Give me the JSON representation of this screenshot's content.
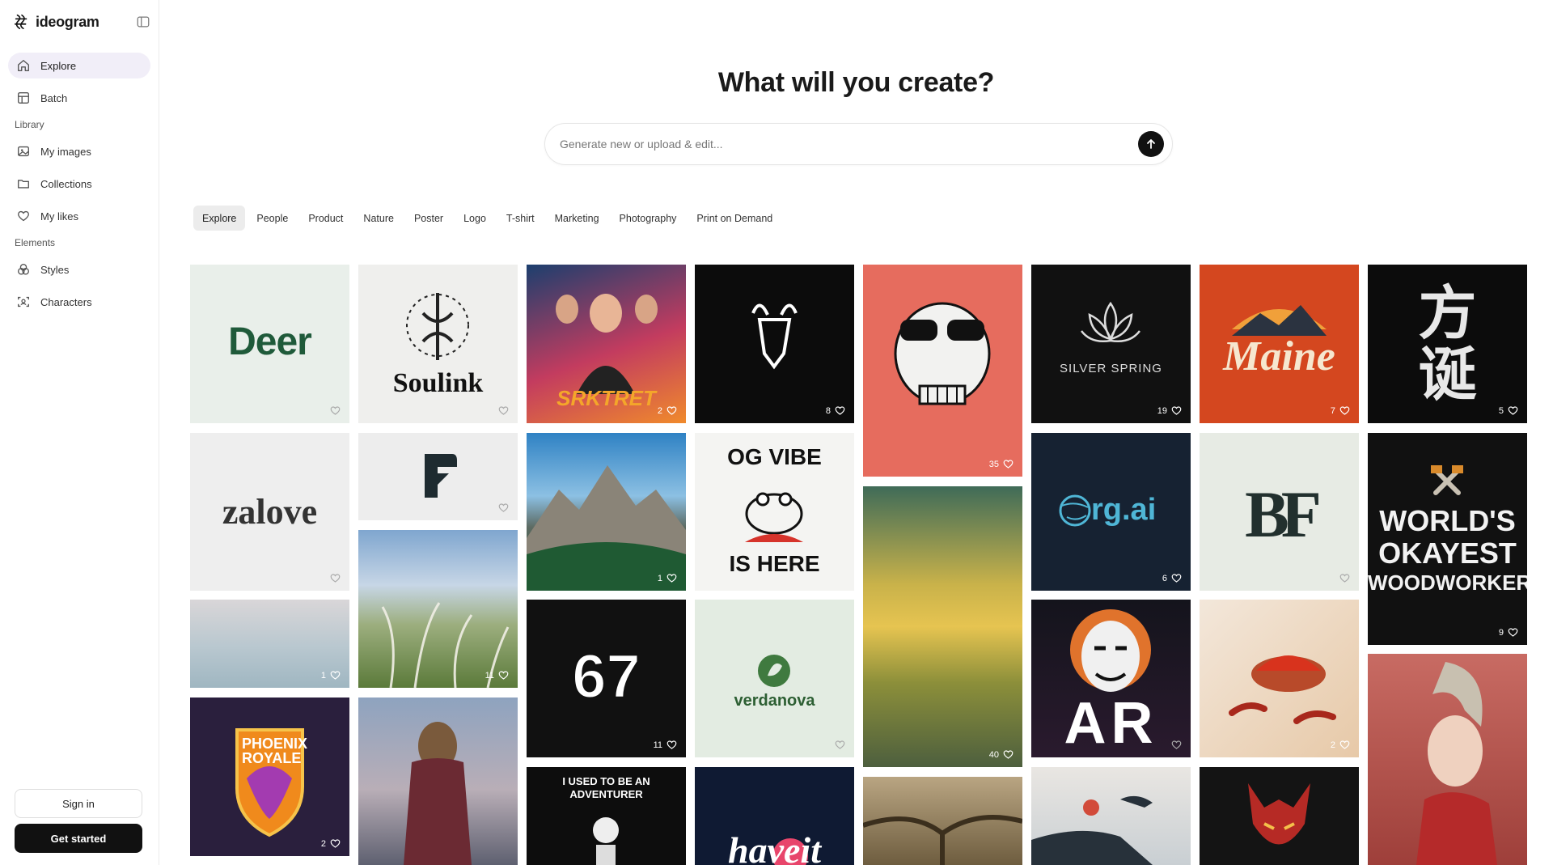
{
  "app": {
    "name": "ideogram"
  },
  "sidebar": {
    "nav": [
      {
        "label": "Explore",
        "icon": "home-icon",
        "active": true
      },
      {
        "label": "Batch",
        "icon": "batch-icon"
      }
    ],
    "library_title": "Library",
    "library": [
      {
        "label": "My images",
        "icon": "images-icon"
      },
      {
        "label": "Collections",
        "icon": "folder-icon"
      },
      {
        "label": "My likes",
        "icon": "heart-icon"
      }
    ],
    "elements_title": "Elements",
    "elements": [
      {
        "label": "Styles",
        "icon": "styles-icon"
      },
      {
        "label": "Characters",
        "icon": "characters-icon"
      }
    ],
    "sign_in": "Sign in",
    "get_started": "Get started"
  },
  "main": {
    "headline": "What will you create?",
    "prompt_placeholder": "Generate new or upload & edit...",
    "tabs": [
      "Explore",
      "People",
      "Product",
      "Nature",
      "Poster",
      "Logo",
      "T-shirt",
      "Marketing",
      "Photography",
      "Print on Demand"
    ],
    "active_tab": "Explore"
  },
  "gallery": {
    "col1": [
      {
        "text": "Deer",
        "likes": ""
      },
      {
        "text": "zalove",
        "likes": ""
      },
      {
        "text": "",
        "likes": "1"
      },
      {
        "text": "PHOENIX ROYALE",
        "likes": "2"
      }
    ],
    "col2": [
      {
        "text": "Soulink",
        "likes": ""
      },
      {
        "text": "",
        "likes": ""
      },
      {
        "text": "",
        "likes": "11"
      }
    ],
    "col3": [
      {
        "text": "SRKTRET",
        "likes": "2"
      },
      {
        "text": "",
        "likes": "1"
      },
      {
        "text": "67",
        "likes": "11"
      },
      {
        "text": "I USED TO BE AN ADVENTURER",
        "likes": ""
      }
    ],
    "col4": [
      {
        "text": "",
        "likes": "8"
      },
      {
        "text": "OG VIBE",
        "text2": "IS HERE",
        "likes": ""
      },
      {
        "text": "verdanova",
        "likes": ""
      },
      {
        "text": "haveit",
        "likes": ""
      }
    ],
    "col5": [
      {
        "text": "",
        "likes": "35"
      },
      {
        "text": "",
        "likes": "40"
      }
    ],
    "col6": [
      {
        "text": "SILVER SPRING",
        "likes": "19"
      },
      {
        "text": "rg.ai",
        "likes": "6"
      },
      {
        "text": "AR",
        "likes": ""
      }
    ],
    "col7": [
      {
        "text": "Maine",
        "likes": "7"
      },
      {
        "text": "BF",
        "likes": ""
      },
      {
        "text": "",
        "likes": "2"
      }
    ],
    "col8": [
      {
        "text": "方诞",
        "likes": "5"
      },
      {
        "text": "WORLD'S",
        "text2": "OKAYEST",
        "text3": "WOODWORKER",
        "likes": "9"
      }
    ]
  },
  "colors": {
    "accent_bg": "#f1eef8",
    "primary": "#111111"
  }
}
